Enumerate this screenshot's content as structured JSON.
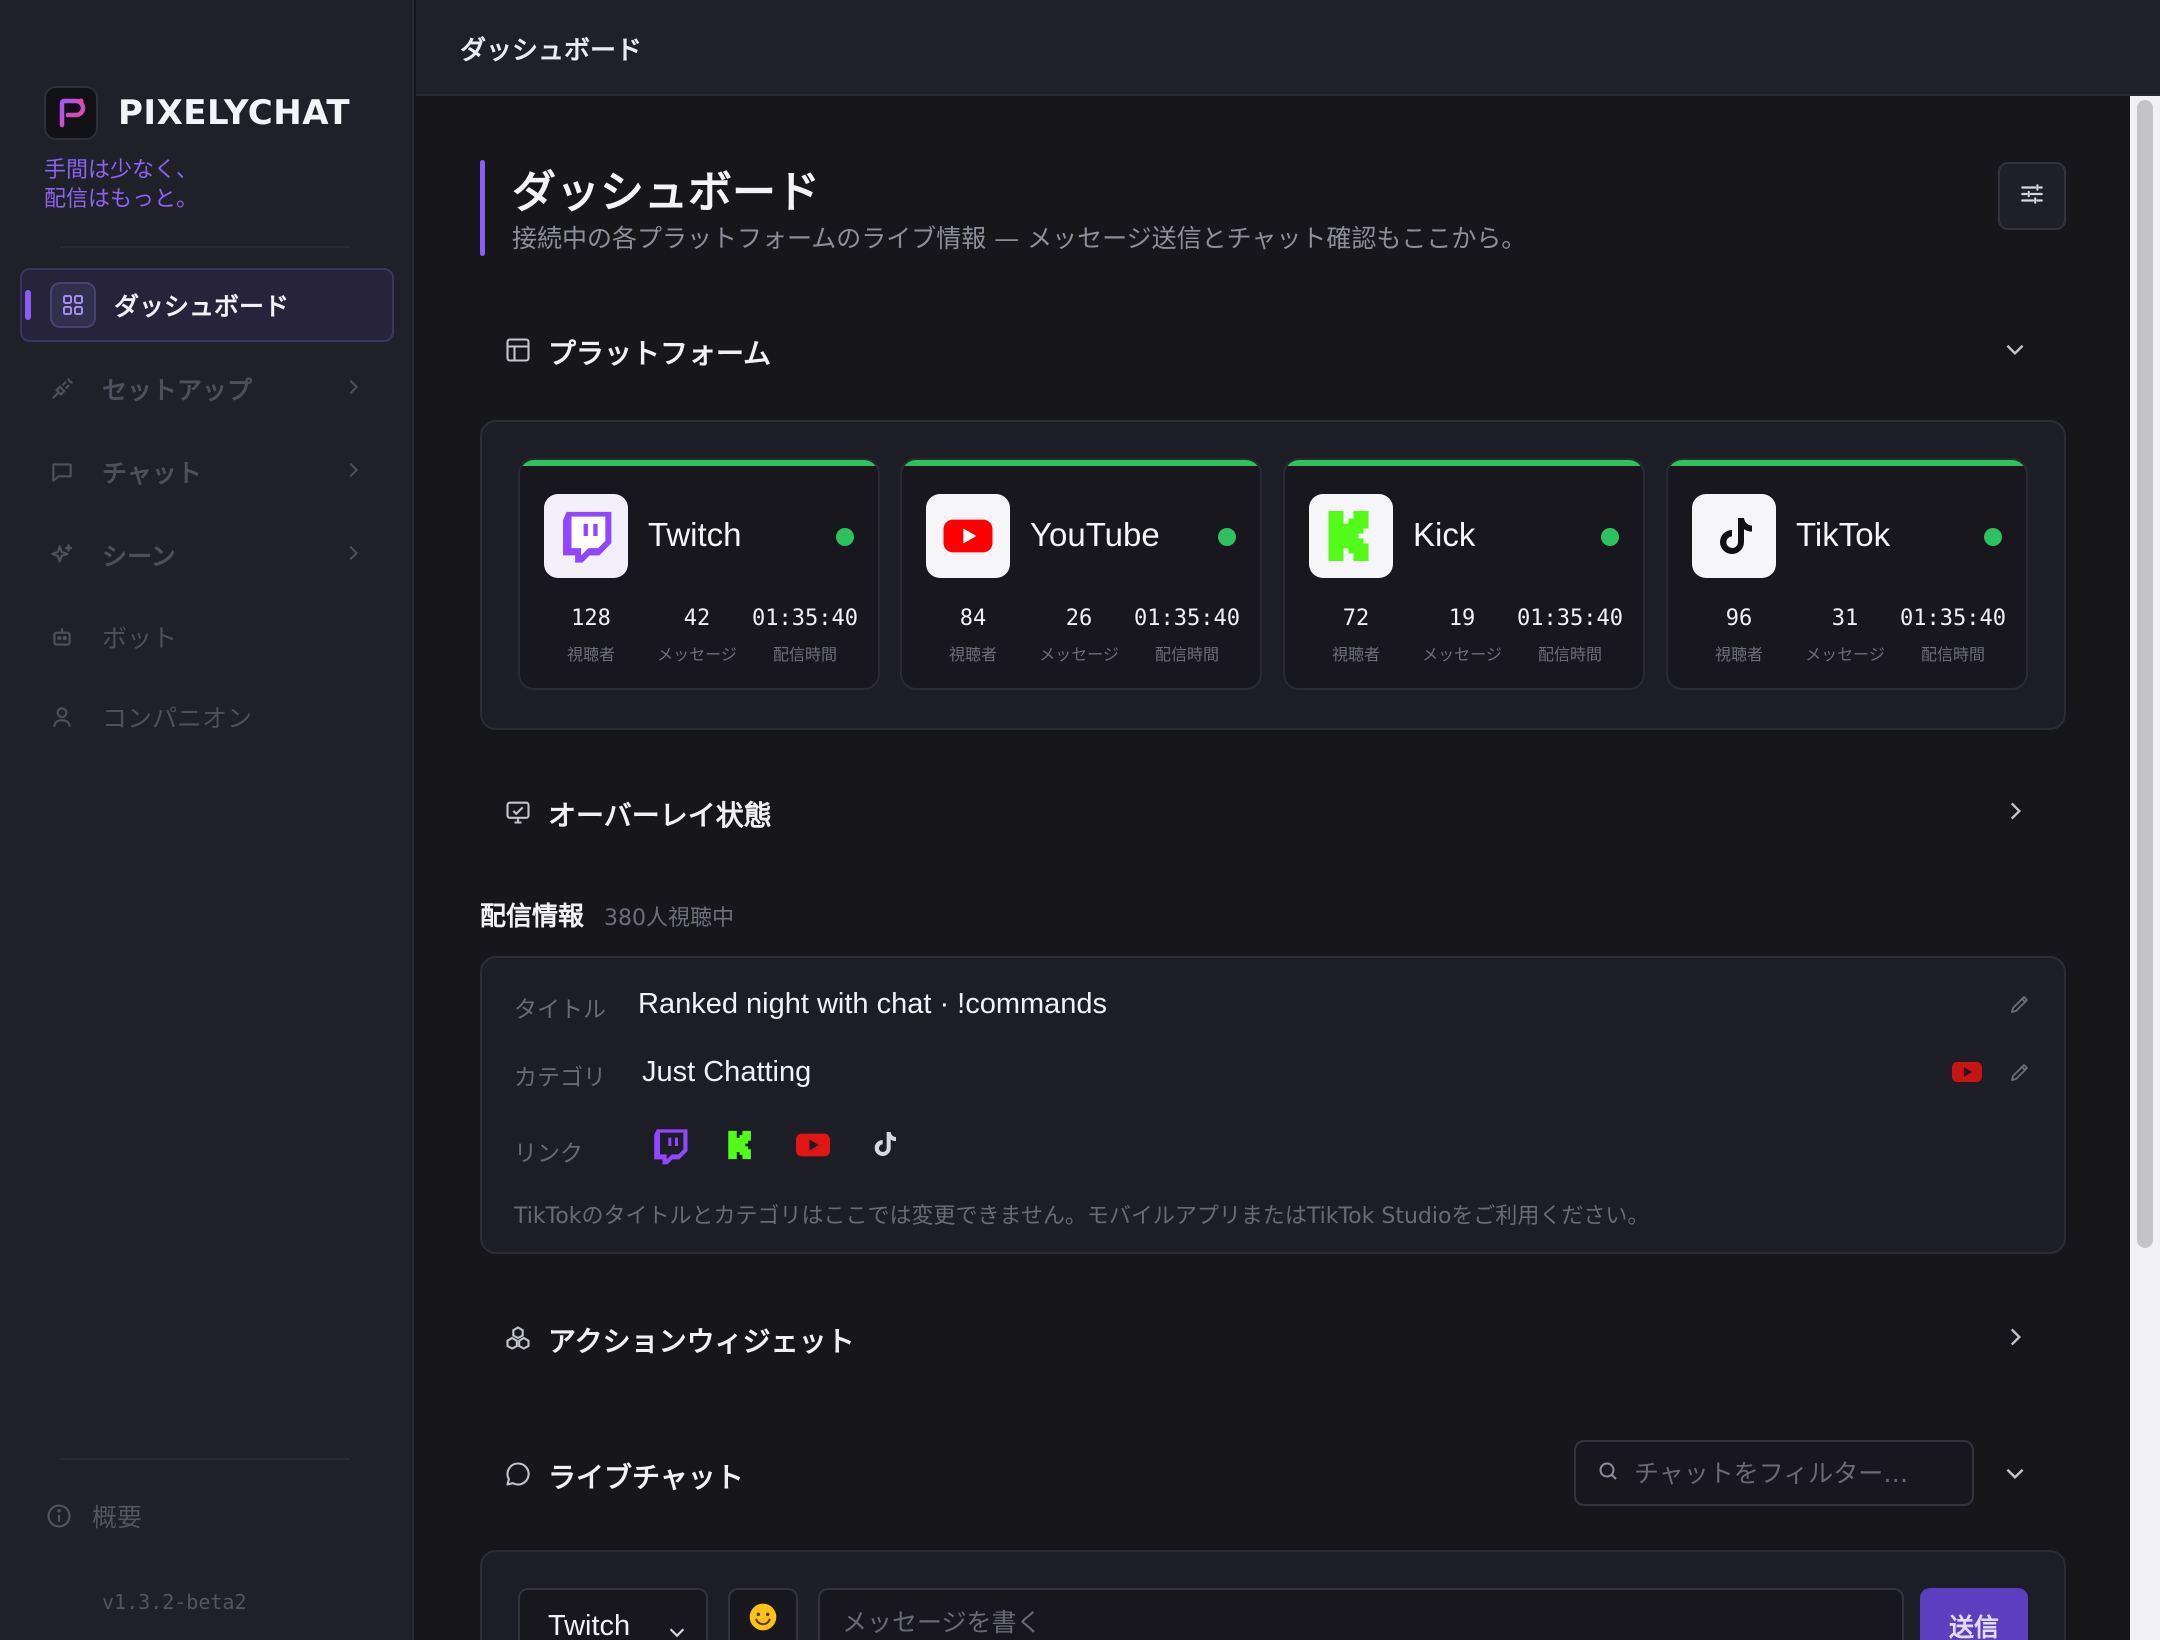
{
  "app": {
    "name": "PIXELYCHAT",
    "tagline_line1": "手間は少なく、",
    "tagline_line2": "配信はもっと。",
    "version": "v1.3.2-beta2"
  },
  "sidebar": {
    "items": [
      {
        "label": "ダッシュボード",
        "icon": "grid-icon",
        "active": true
      },
      {
        "label": "セットアップ",
        "icon": "plug-icon",
        "has_submenu": true
      },
      {
        "label": "チャット",
        "icon": "chat-bubble-icon",
        "has_submenu": true
      },
      {
        "label": "シーン",
        "icon": "sparkles-icon",
        "has_submenu": true
      },
      {
        "label": "ボット",
        "icon": "bot-icon"
      },
      {
        "label": "コンパニオン",
        "icon": "user-icon"
      }
    ],
    "footer_label": "概要"
  },
  "topbar": {
    "title": "ダッシュボード"
  },
  "page": {
    "title": "ダッシュボード",
    "subtitle": "接続中の各プラットフォームのライブ情報 — メッセージ送信とチャット確認もここから。"
  },
  "sections": {
    "platforms": "プラットフォーム",
    "overlay": "オーバーレイ状態",
    "stream_info": "配信情報",
    "stream_info_viewers": "380人視聴中",
    "action_widgets": "アクションウィジェット",
    "live_chat": "ライブチャット"
  },
  "platforms": [
    {
      "name": "Twitch",
      "viewers": "128",
      "messages": "42",
      "uptime": "01:35:40",
      "status": "online"
    },
    {
      "name": "YouTube",
      "viewers": "84",
      "messages": "26",
      "uptime": "01:35:40",
      "status": "online"
    },
    {
      "name": "Kick",
      "viewers": "72",
      "messages": "19",
      "uptime": "01:35:40",
      "status": "online"
    },
    {
      "name": "TikTok",
      "viewers": "96",
      "messages": "31",
      "uptime": "01:35:40",
      "status": "online"
    }
  ],
  "stat_labels": {
    "viewers": "視聴者",
    "messages": "メッセージ",
    "uptime": "配信時間"
  },
  "stream_info": {
    "title_label": "タイトル",
    "title_value": "Ranked night with chat · !commands",
    "category_label": "カテゴリ",
    "category_value": "Just Chatting",
    "links_label": "リンク",
    "note": "TikTokのタイトルとカテゴリはここでは変更できません。モバイルアプリまたはTikTok Studioをご利用ください。"
  },
  "chat": {
    "filter_placeholder": "チャットをフィルター…",
    "platform_select": "Twitch",
    "message_placeholder": "メッセージを書く",
    "send_label": "送信"
  },
  "colors": {
    "accent": "#8b5cf6",
    "online": "#2ec15e",
    "twitch": "#9146ff",
    "youtube": "#ff0000",
    "kick": "#53fc18"
  }
}
